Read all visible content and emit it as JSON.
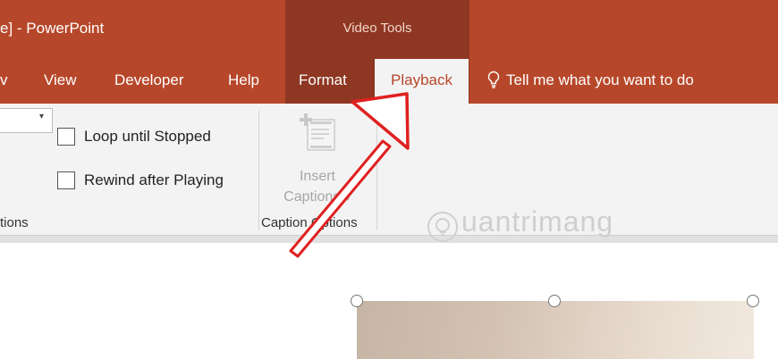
{
  "window": {
    "title": "e]  -  PowerPoint",
    "contextual_group": "Video Tools"
  },
  "tabs": {
    "view": "View",
    "developer": "Developer",
    "help": "Help",
    "format": "Format",
    "playback": "Playback",
    "tell_me": "Tell me what you want to do"
  },
  "ribbon": {
    "loop_label": "Loop until Stopped",
    "loop_checked": false,
    "rewind_label": "Rewind after Playing",
    "rewind_checked": false,
    "group_options_label": "tions",
    "insert_captions_line1": "Insert",
    "insert_captions_line2": "Captions",
    "caption_options_label": "Caption Options"
  },
  "watermark": "uantrimang",
  "colors": {
    "accent": "#b7472a",
    "contextual": "#8e3722",
    "ribbon_bg": "#f3f3f3",
    "arrow": "#e02020"
  },
  "icons": {
    "tell_me": "lightbulb-icon",
    "insert_captions": "insert-captions-icon",
    "dropdown": "chevron-down-icon",
    "watermark": "watermark-logo-icon"
  }
}
